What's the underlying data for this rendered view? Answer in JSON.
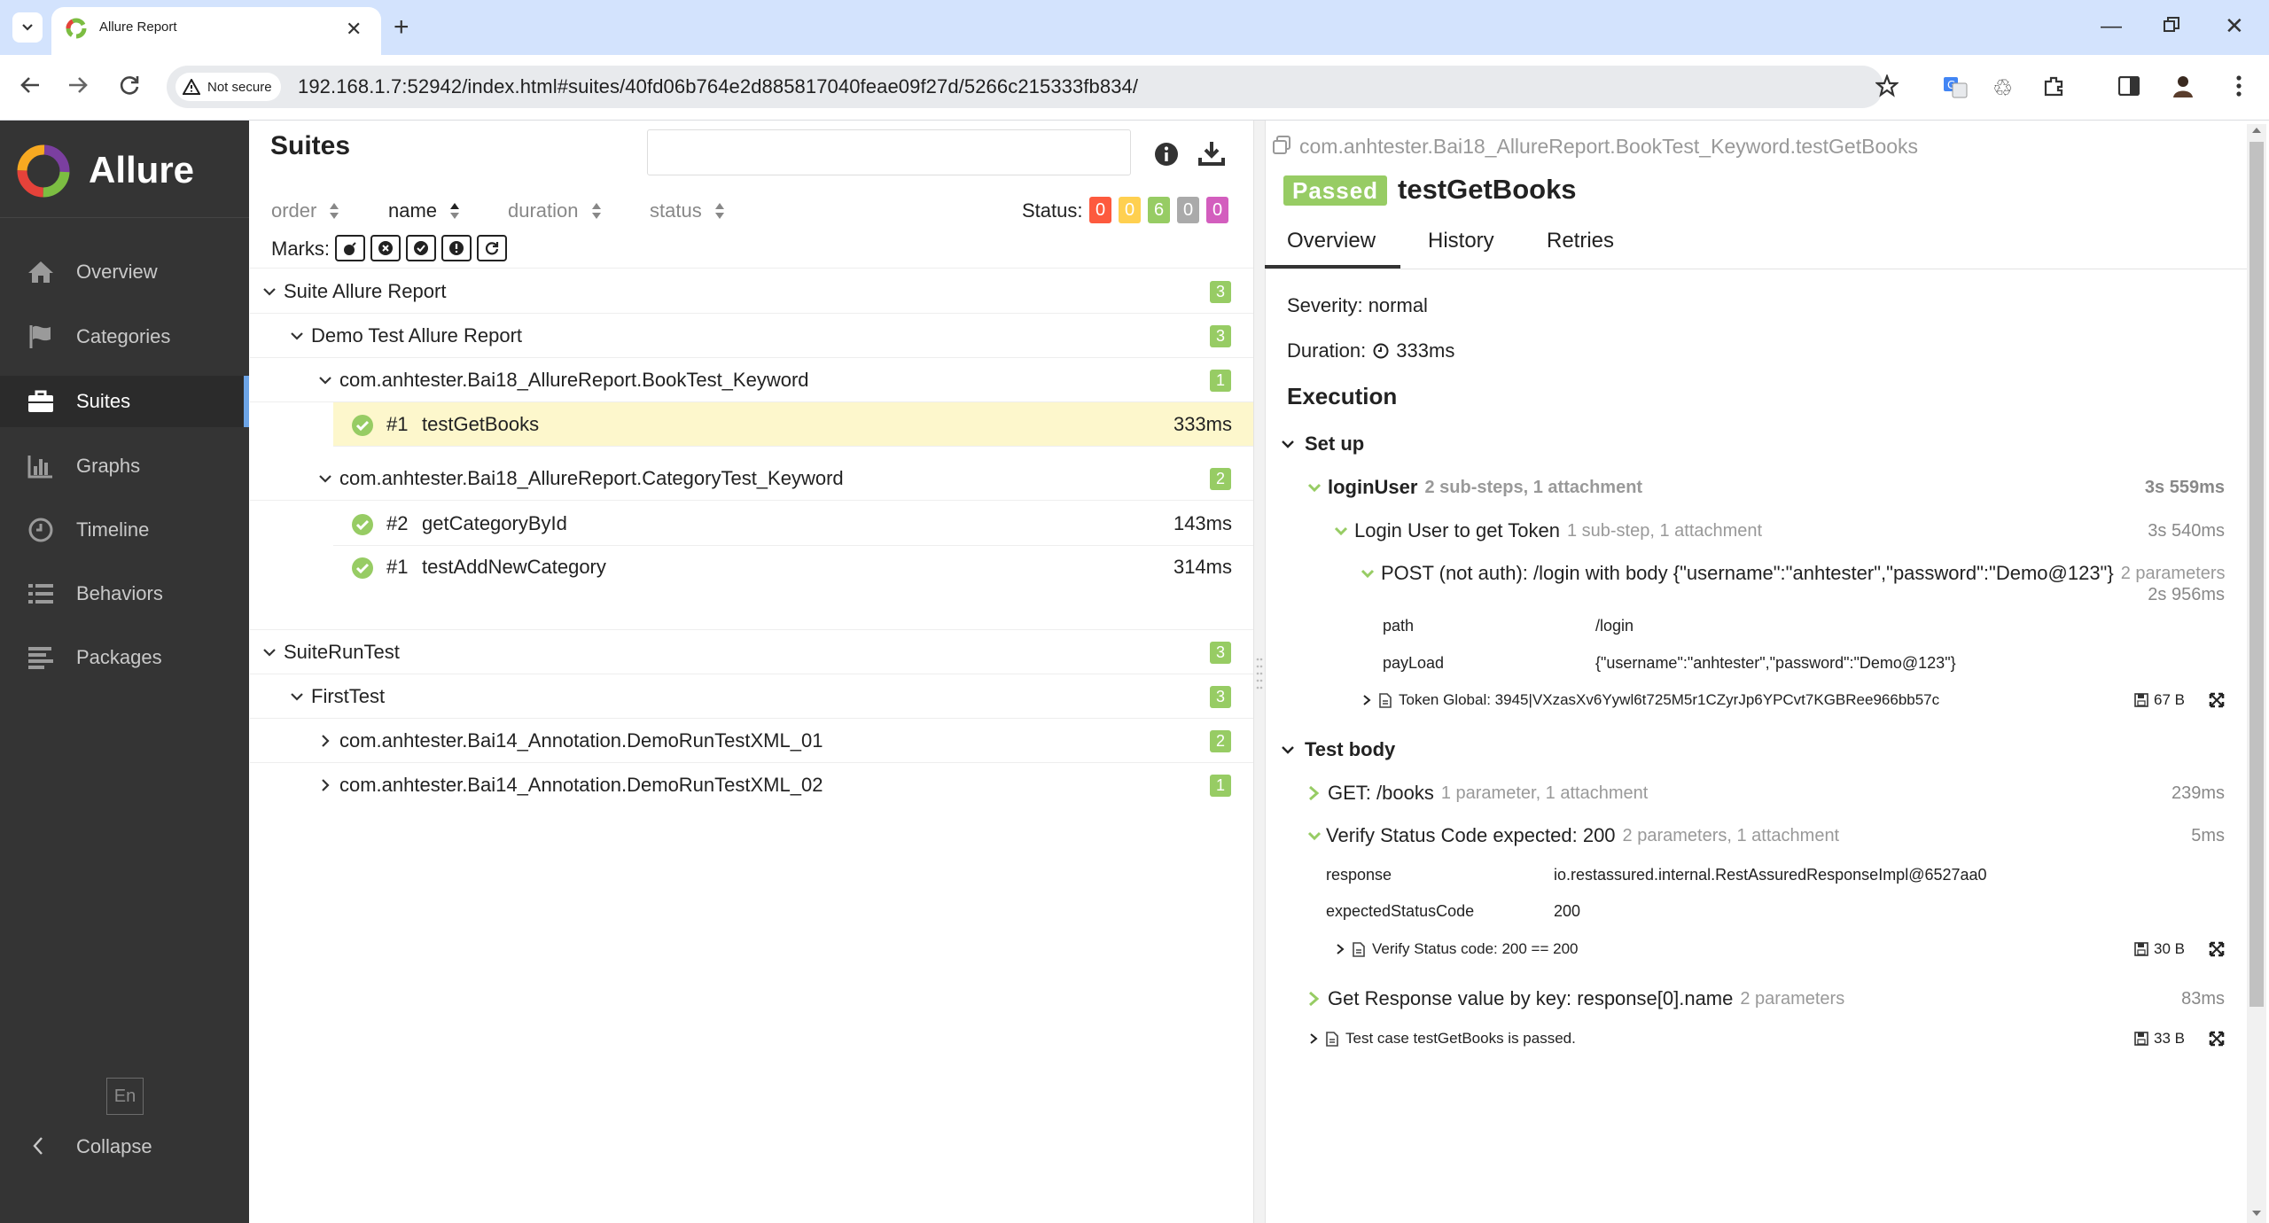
{
  "browser": {
    "tab_title": "Allure Report",
    "not_secure": "Not secure",
    "url": "192.168.1.7:52942/index.html#suites/40fd06b764e2d885817040feae09f27d/5266c215333fb834/"
  },
  "sidebar": {
    "brand": "Allure",
    "items": [
      {
        "label": "Overview",
        "icon": "home-icon"
      },
      {
        "label": "Categories",
        "icon": "flag-icon"
      },
      {
        "label": "Suites",
        "icon": "briefcase-icon"
      },
      {
        "label": "Graphs",
        "icon": "bar-chart-icon"
      },
      {
        "label": "Timeline",
        "icon": "clock-icon"
      },
      {
        "label": "Behaviors",
        "icon": "list-icon"
      },
      {
        "label": "Packages",
        "icon": "align-left-icon"
      }
    ],
    "active": "Suites",
    "lang": "En",
    "collapse": "Collapse"
  },
  "suites_panel": {
    "title": "Suites",
    "sort": {
      "order": "order",
      "name": "name",
      "duration": "duration",
      "status": "status"
    },
    "status_label": "Status:",
    "status_counts": [
      {
        "value": "0",
        "color": "#fd5a3e"
      },
      {
        "value": "0",
        "color": "#ffd050"
      },
      {
        "value": "6",
        "color": "#97cc64"
      },
      {
        "value": "0",
        "color": "#aaaaaa"
      },
      {
        "value": "0",
        "color": "#d35ebe"
      }
    ],
    "marks_label": "Marks:",
    "tree": {
      "suite1": {
        "name": "Suite Allure Report",
        "count": "3"
      },
      "demo": {
        "name": "Demo Test Allure Report",
        "count": "3"
      },
      "bookclass": {
        "name": "com.anhtester.Bai18_AllureReport.BookTest_Keyword",
        "count": "1"
      },
      "t1": {
        "num": "#1",
        "name": "testGetBooks",
        "dur": "333ms"
      },
      "catclass": {
        "name": "com.anhtester.Bai18_AllureReport.CategoryTest_Keyword",
        "count": "2"
      },
      "t2": {
        "num": "#2",
        "name": "getCategoryById",
        "dur": "143ms"
      },
      "t3": {
        "num": "#1",
        "name": "testAddNewCategory",
        "dur": "314ms"
      },
      "suite2": {
        "name": "SuiteRunTest",
        "count": "3"
      },
      "first": {
        "name": "FirstTest",
        "count": "3"
      },
      "xml1": {
        "name": "com.anhtester.Bai14_Annotation.DemoRunTestXML_01",
        "count": "2"
      },
      "xml2": {
        "name": "com.anhtester.Bai14_Annotation.DemoRunTestXML_02",
        "count": "1"
      }
    }
  },
  "detail": {
    "path": "com.anhtester.Bai18_AllureReport.BookTest_Keyword.testGetBooks",
    "status": "Passed",
    "title": "testGetBooks",
    "tabs": {
      "overview": "Overview",
      "history": "History",
      "retries": "Retries"
    },
    "severity": "Severity: normal",
    "duration_label": "Duration:",
    "duration_value": "333ms",
    "execution": "Execution",
    "setup": {
      "title": "Set up",
      "login_user": {
        "name": "loginUser",
        "meta": "2 sub-steps, 1 attachment",
        "time": "3s 559ms"
      },
      "login_token": {
        "name": "Login User to get Token",
        "meta": "1 sub-step, 1 attachment",
        "time": "3s 540ms"
      },
      "post": {
        "name": "POST (not auth): /login with body {\"username\":\"anhtester\",\"password\":\"Demo@123\"}",
        "meta": "2 parameters",
        "time": "2s 956ms"
      },
      "params": [
        {
          "key": "path",
          "value": "/login"
        },
        {
          "key": "payLoad",
          "value": "{\"username\":\"anhtester\",\"password\":\"Demo@123\"}"
        }
      ],
      "attachment": {
        "name": "Token Global: 3945|VXzasXv6Yywl6t725M5r1CZyrJp6YPCvt7KGBRee966bb57c",
        "size": "67 B"
      }
    },
    "body": {
      "title": "Test body",
      "get": {
        "name": "GET: /books",
        "meta": "1 parameter, 1 attachment",
        "time": "239ms"
      },
      "verify": {
        "name": "Verify Status Code expected: 200",
        "meta": "2 parameters, 1 attachment",
        "time": "5ms"
      },
      "params": [
        {
          "key": "response",
          "value": "io.restassured.internal.RestAssuredResponseImpl@6527aa0"
        },
        {
          "key": "expectedStatusCode",
          "value": "200"
        }
      ],
      "verify_att": {
        "name": "Verify Status code: 200 == 200",
        "size": "30 B"
      },
      "response": {
        "name": "Get Response value by key: response[0].name",
        "meta": "2 parameters",
        "time": "83ms"
      },
      "final_att": {
        "name": "Test case testGetBooks is passed.",
        "size": "33 B"
      }
    }
  }
}
